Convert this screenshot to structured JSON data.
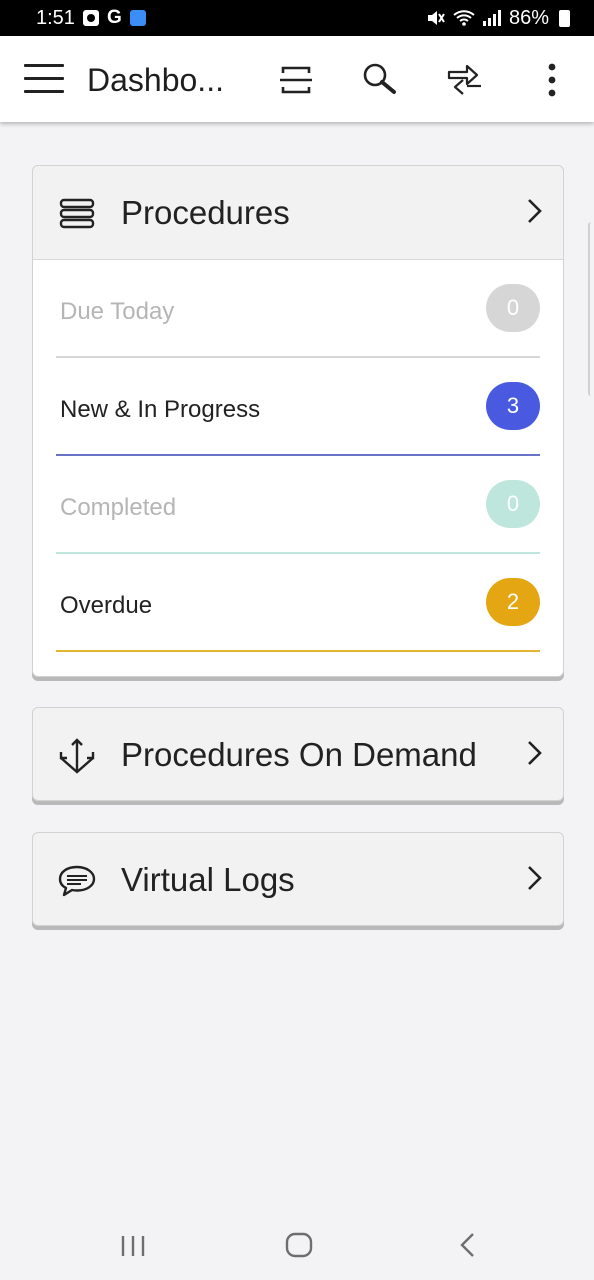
{
  "status_bar": {
    "time": "1:51",
    "g_label": "G",
    "battery": "86%"
  },
  "app_bar": {
    "title": "Dashbo..."
  },
  "procedures": {
    "title": "Procedures",
    "rows": [
      {
        "label": "Due Today",
        "count": "0",
        "label_color": "#b5b5b5",
        "badge_color": "#d6d6d6",
        "line_color": "#d6d6d6"
      },
      {
        "label": "New & In Progress",
        "count": "3",
        "label_color": "#222222",
        "badge_color": "#4a5ae0",
        "line_color": "#6a72c8"
      },
      {
        "label": "Completed",
        "count": "0",
        "label_color": "#b5b5b5",
        "badge_color": "#bfe6dc",
        "line_color": "#bfe6dc"
      },
      {
        "label": "Overdue",
        "count": "2",
        "label_color": "#222222",
        "badge_color": "#e4a612",
        "line_color": "#e4b430"
      }
    ]
  },
  "procedures_on_demand": {
    "title": "Procedures On Demand"
  },
  "virtual_logs": {
    "title": "Virtual Logs"
  }
}
